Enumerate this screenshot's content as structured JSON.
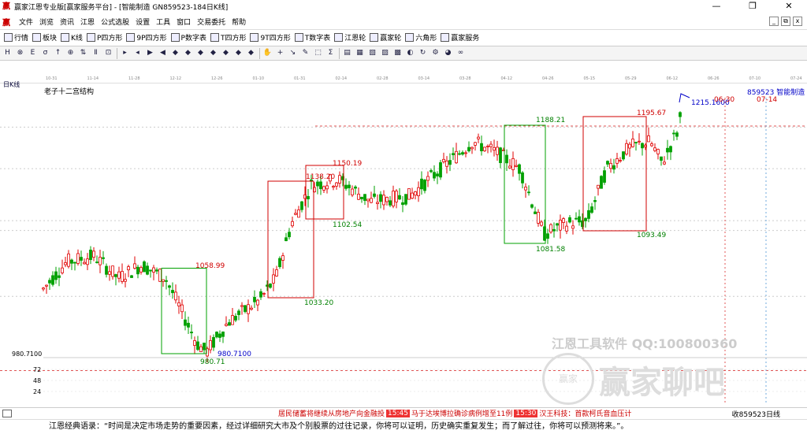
{
  "window": {
    "title": "赢家江恩专业版[赢家服务平台] - [智能制造  GN859523-184日K线]",
    "minimize": "—",
    "maximize": "❐",
    "close": "✕"
  },
  "menu": {
    "items": [
      "文件",
      "浏览",
      "资讯",
      "江恩",
      "公式选股",
      "设置",
      "工具",
      "窗口",
      "交易委托",
      "帮助"
    ],
    "right_buttons": [
      "_",
      "⧉",
      "x"
    ]
  },
  "toolbar1": {
    "items": [
      {
        "label": "行情",
        "icon": "grid-icon"
      },
      {
        "label": "板块",
        "icon": "blocks-icon"
      },
      {
        "label": "K线",
        "icon": "candlestick-icon"
      },
      {
        "label": "P四方形",
        "icon": "square-p-icon"
      },
      {
        "label": "9P四方形",
        "icon": "square-9p-icon"
      },
      {
        "label": "P数字表",
        "icon": "table-p-icon"
      },
      {
        "label": "T四方形",
        "icon": "square-t-icon"
      },
      {
        "label": "9T四方形",
        "icon": "square-9t-icon"
      },
      {
        "label": "T数字表",
        "icon": "table-t-icon"
      },
      {
        "label": "江恩轮",
        "icon": "wheel-icon"
      },
      {
        "label": "赢家轮",
        "icon": "winner-wheel-icon"
      },
      {
        "label": "六角形",
        "icon": "hexagon-icon"
      },
      {
        "label": "赢家服务",
        "icon": "service-icon"
      }
    ]
  },
  "toolbar2": {
    "buttons": [
      "H",
      "⊗",
      "Ε",
      "σ",
      "↑",
      "⊕",
      "⇅",
      "Ⅱ",
      "⊡",
      "▸",
      "◂",
      "▶",
      "◀",
      "◆",
      "◆",
      "◆",
      "◆",
      "◆",
      "◆",
      "◆",
      "✋",
      "+",
      "↘",
      "✎",
      "⬚",
      "Σ",
      "▤",
      "▦",
      "▧",
      "▨",
      "▩",
      "◐",
      "↻",
      "⚙",
      "◕",
      "∞"
    ]
  },
  "chart": {
    "view_label": "日K线",
    "structure_label": "老子十二宫结构",
    "stock_label": "859523  智能制造",
    "date_ticks": [
      "10-31",
      "11-14",
      "11-28",
      "12-12",
      "12-26",
      "01-10",
      "01-31",
      "02-14",
      "02-28",
      "03-14",
      "03-28",
      "04-12",
      "04-26",
      "05-15",
      "05-29",
      "06-12",
      "06-26",
      "07-10",
      "07-24"
    ],
    "price_annotations": [
      {
        "text": "1058.99",
        "color": "#d00000"
      },
      {
        "text": "980.71",
        "color": "#008000"
      },
      {
        "text": "980.7100",
        "color": "#0000c8"
      },
      {
        "text": "1138.20",
        "color": "#d00000"
      },
      {
        "text": "1033.20",
        "color": "#008000"
      },
      {
        "text": "1150.19",
        "color": "#d00000"
      },
      {
        "text": "1102.54",
        "color": "#008000"
      },
      {
        "text": "1188.21",
        "color": "#008000"
      },
      {
        "text": "1081.58",
        "color": "#008000"
      },
      {
        "text": "1195.67",
        "color": "#d00000"
      },
      {
        "text": "1093.49",
        "color": "#008000"
      },
      {
        "text": "1215.1600",
        "color": "#0000c8"
      },
      {
        "text": "06-30",
        "color": "#d00000"
      },
      {
        "text": "07-14",
        "color": "#d00000"
      }
    ],
    "axis_price": "980.7100",
    "volume_ticks": [
      "72",
      "48",
      "24"
    ]
  },
  "chart_data": {
    "type": "candlestick",
    "title": "老子十二宫结构",
    "annotated_levels": [
      980.71,
      1033.2,
      1058.99,
      1081.58,
      1093.49,
      1102.54,
      1138.2,
      1150.19,
      1188.21,
      1195.67,
      1215.16
    ],
    "x_dates": [
      "10-31",
      "11-14",
      "11-28",
      "12-12",
      "12-26",
      "01-10",
      "01-31",
      "02-14",
      "02-28",
      "03-14",
      "03-28",
      "04-12",
      "04-26",
      "05-15",
      "05-29",
      "06-12",
      "06-26",
      "07-10",
      "07-24"
    ]
  },
  "watermark": {
    "tools": "江恩工具软件  QQ:100800360",
    "brand": "赢家聊吧",
    "logo": "赢家"
  },
  "statusbar": {
    "news1": "居民储蓄将继续从房地产向金融投",
    "time1": "15:45",
    "news2": "马于达埃博拉确诊病例增至11例",
    "time2": "15:30",
    "news3": "汉王科技：首款柯氏音血压计",
    "right": "收859523日线"
  },
  "quote": "江恩经典语录：“时间是决定市场走势的重要因素，经过详细研究大市及个别股票的过往记录，你将可以证明，历史确实重复发生；而了解过往，你将可以预测将来。”。"
}
